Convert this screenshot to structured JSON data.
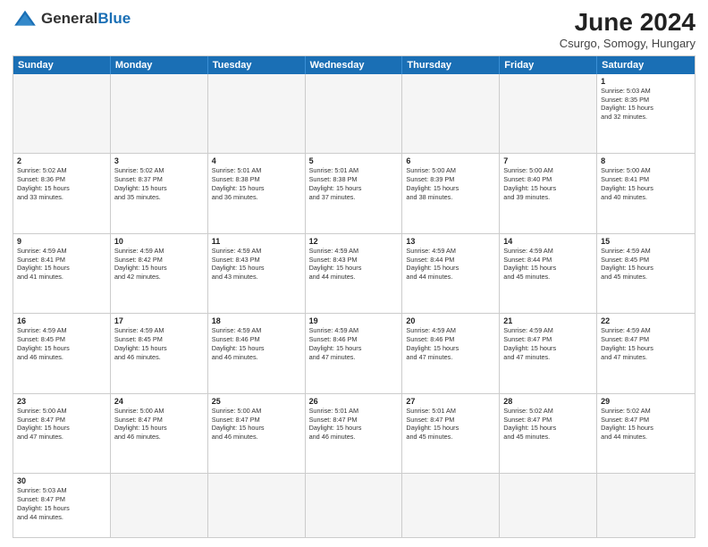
{
  "header": {
    "logo_general": "General",
    "logo_blue": "Blue",
    "month_year": "June 2024",
    "location": "Csurgo, Somogy, Hungary"
  },
  "days_of_week": [
    "Sunday",
    "Monday",
    "Tuesday",
    "Wednesday",
    "Thursday",
    "Friday",
    "Saturday"
  ],
  "rows": [
    [
      {
        "day": "",
        "text": ""
      },
      {
        "day": "",
        "text": ""
      },
      {
        "day": "",
        "text": ""
      },
      {
        "day": "",
        "text": ""
      },
      {
        "day": "",
        "text": ""
      },
      {
        "day": "",
        "text": ""
      },
      {
        "day": "1",
        "text": "Sunrise: 5:03 AM\nSunset: 8:35 PM\nDaylight: 15 hours\nand 32 minutes."
      }
    ],
    [
      {
        "day": "2",
        "text": "Sunrise: 5:02 AM\nSunset: 8:36 PM\nDaylight: 15 hours\nand 33 minutes."
      },
      {
        "day": "3",
        "text": "Sunrise: 5:02 AM\nSunset: 8:37 PM\nDaylight: 15 hours\nand 35 minutes."
      },
      {
        "day": "4",
        "text": "Sunrise: 5:01 AM\nSunset: 8:38 PM\nDaylight: 15 hours\nand 36 minutes."
      },
      {
        "day": "5",
        "text": "Sunrise: 5:01 AM\nSunset: 8:38 PM\nDaylight: 15 hours\nand 37 minutes."
      },
      {
        "day": "6",
        "text": "Sunrise: 5:00 AM\nSunset: 8:39 PM\nDaylight: 15 hours\nand 38 minutes."
      },
      {
        "day": "7",
        "text": "Sunrise: 5:00 AM\nSunset: 8:40 PM\nDaylight: 15 hours\nand 39 minutes."
      },
      {
        "day": "8",
        "text": "Sunrise: 5:00 AM\nSunset: 8:41 PM\nDaylight: 15 hours\nand 40 minutes."
      }
    ],
    [
      {
        "day": "9",
        "text": "Sunrise: 4:59 AM\nSunset: 8:41 PM\nDaylight: 15 hours\nand 41 minutes."
      },
      {
        "day": "10",
        "text": "Sunrise: 4:59 AM\nSunset: 8:42 PM\nDaylight: 15 hours\nand 42 minutes."
      },
      {
        "day": "11",
        "text": "Sunrise: 4:59 AM\nSunset: 8:43 PM\nDaylight: 15 hours\nand 43 minutes."
      },
      {
        "day": "12",
        "text": "Sunrise: 4:59 AM\nSunset: 8:43 PM\nDaylight: 15 hours\nand 44 minutes."
      },
      {
        "day": "13",
        "text": "Sunrise: 4:59 AM\nSunset: 8:44 PM\nDaylight: 15 hours\nand 44 minutes."
      },
      {
        "day": "14",
        "text": "Sunrise: 4:59 AM\nSunset: 8:44 PM\nDaylight: 15 hours\nand 45 minutes."
      },
      {
        "day": "15",
        "text": "Sunrise: 4:59 AM\nSunset: 8:45 PM\nDaylight: 15 hours\nand 45 minutes."
      }
    ],
    [
      {
        "day": "16",
        "text": "Sunrise: 4:59 AM\nSunset: 8:45 PM\nDaylight: 15 hours\nand 46 minutes."
      },
      {
        "day": "17",
        "text": "Sunrise: 4:59 AM\nSunset: 8:45 PM\nDaylight: 15 hours\nand 46 minutes."
      },
      {
        "day": "18",
        "text": "Sunrise: 4:59 AM\nSunset: 8:46 PM\nDaylight: 15 hours\nand 46 minutes."
      },
      {
        "day": "19",
        "text": "Sunrise: 4:59 AM\nSunset: 8:46 PM\nDaylight: 15 hours\nand 47 minutes."
      },
      {
        "day": "20",
        "text": "Sunrise: 4:59 AM\nSunset: 8:46 PM\nDaylight: 15 hours\nand 47 minutes."
      },
      {
        "day": "21",
        "text": "Sunrise: 4:59 AM\nSunset: 8:47 PM\nDaylight: 15 hours\nand 47 minutes."
      },
      {
        "day": "22",
        "text": "Sunrise: 4:59 AM\nSunset: 8:47 PM\nDaylight: 15 hours\nand 47 minutes."
      }
    ],
    [
      {
        "day": "23",
        "text": "Sunrise: 5:00 AM\nSunset: 8:47 PM\nDaylight: 15 hours\nand 47 minutes."
      },
      {
        "day": "24",
        "text": "Sunrise: 5:00 AM\nSunset: 8:47 PM\nDaylight: 15 hours\nand 46 minutes."
      },
      {
        "day": "25",
        "text": "Sunrise: 5:00 AM\nSunset: 8:47 PM\nDaylight: 15 hours\nand 46 minutes."
      },
      {
        "day": "26",
        "text": "Sunrise: 5:01 AM\nSunset: 8:47 PM\nDaylight: 15 hours\nand 46 minutes."
      },
      {
        "day": "27",
        "text": "Sunrise: 5:01 AM\nSunset: 8:47 PM\nDaylight: 15 hours\nand 45 minutes."
      },
      {
        "day": "28",
        "text": "Sunrise: 5:02 AM\nSunset: 8:47 PM\nDaylight: 15 hours\nand 45 minutes."
      },
      {
        "day": "29",
        "text": "Sunrise: 5:02 AM\nSunset: 8:47 PM\nDaylight: 15 hours\nand 44 minutes."
      }
    ]
  ],
  "last_row": {
    "day": "30",
    "text": "Sunrise: 5:03 AM\nSunset: 8:47 PM\nDaylight: 15 hours\nand 44 minutes."
  }
}
